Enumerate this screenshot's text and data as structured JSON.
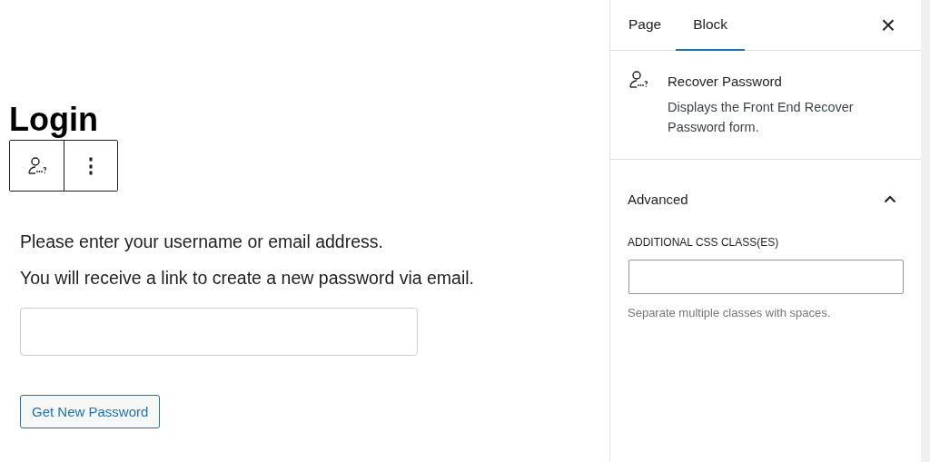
{
  "editor": {
    "heading": "Login",
    "toolbar": {
      "more_button": "⋮"
    },
    "paragraphs": [
      "Please enter your username or email address.",
      "You will receive a link to create a new password via email."
    ],
    "submit_button": "Get New Password"
  },
  "sidebar": {
    "tabs": [
      {
        "label": "Page",
        "selected": false
      },
      {
        "label": "Block",
        "selected": true
      }
    ],
    "close_button": "×",
    "block": {
      "title": "Recover Password",
      "description": "Displays the Front End Recover Password form."
    },
    "panel": {
      "title": "Advanced",
      "expanded": true,
      "field_label": "ADDITIONAL CSS CLASS(ES)",
      "help": "Separate multiple classes with spaces."
    }
  }
}
